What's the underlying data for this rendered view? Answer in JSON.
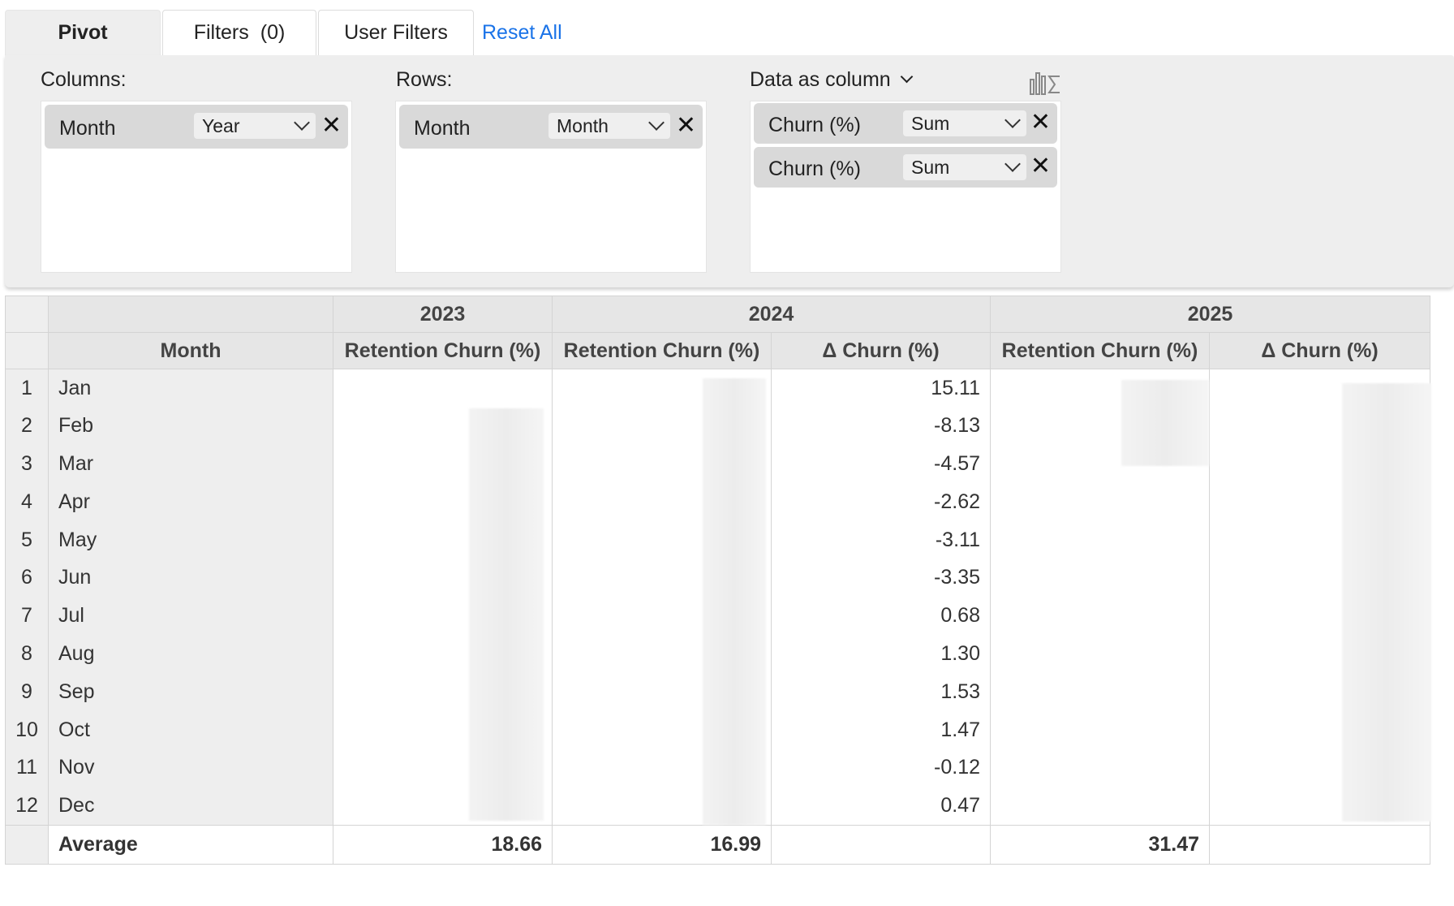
{
  "tabs": {
    "pivot": "Pivot",
    "filters": "Filters",
    "filters_count": "(0)",
    "user_filters": "User Filters",
    "reset_all": "Reset All"
  },
  "config": {
    "columns_label": "Columns:",
    "rows_label": "Rows:",
    "data_label": "Data as column",
    "column_chips": [
      {
        "label": "Month",
        "aggregation": "Year"
      }
    ],
    "row_chips": [
      {
        "label": "Month",
        "aggregation": "Month"
      }
    ],
    "data_chips": [
      {
        "label": "Churn (%)",
        "aggregation": "Sum"
      },
      {
        "label": "Churn (%)",
        "aggregation": "Sum"
      }
    ],
    "icon": "bars-sigma-icon"
  },
  "table": {
    "years": [
      "2023",
      "2024",
      "2025"
    ],
    "row_header": "Month",
    "col_headers": [
      "Retention Churn (%)",
      "Retention Churn (%)",
      "Δ Churn (%)",
      "Retention Churn (%)",
      "Δ Churn (%)"
    ],
    "rows": [
      {
        "n": "1",
        "month": "Jan",
        "delta_2024": "15.11"
      },
      {
        "n": "2",
        "month": "Feb",
        "delta_2024": "-8.13"
      },
      {
        "n": "3",
        "month": "Mar",
        "delta_2024": "-4.57"
      },
      {
        "n": "4",
        "month": "Apr",
        "delta_2024": "-2.62"
      },
      {
        "n": "5",
        "month": "May",
        "delta_2024": "-3.11"
      },
      {
        "n": "6",
        "month": "Jun",
        "delta_2024": "-3.35"
      },
      {
        "n": "7",
        "month": "Jul",
        "delta_2024": "0.68"
      },
      {
        "n": "8",
        "month": "Aug",
        "delta_2024": "1.30"
      },
      {
        "n": "9",
        "month": "Sep",
        "delta_2024": "1.53"
      },
      {
        "n": "10",
        "month": "Oct",
        "delta_2024": "1.47"
      },
      {
        "n": "11",
        "month": "Nov",
        "delta_2024": "-0.12"
      },
      {
        "n": "12",
        "month": "Dec",
        "delta_2024": "0.47"
      }
    ],
    "average": {
      "label": "Average",
      "ret_2023": "18.66",
      "ret_2024": "16.99",
      "ret_2025": "31.47"
    }
  }
}
